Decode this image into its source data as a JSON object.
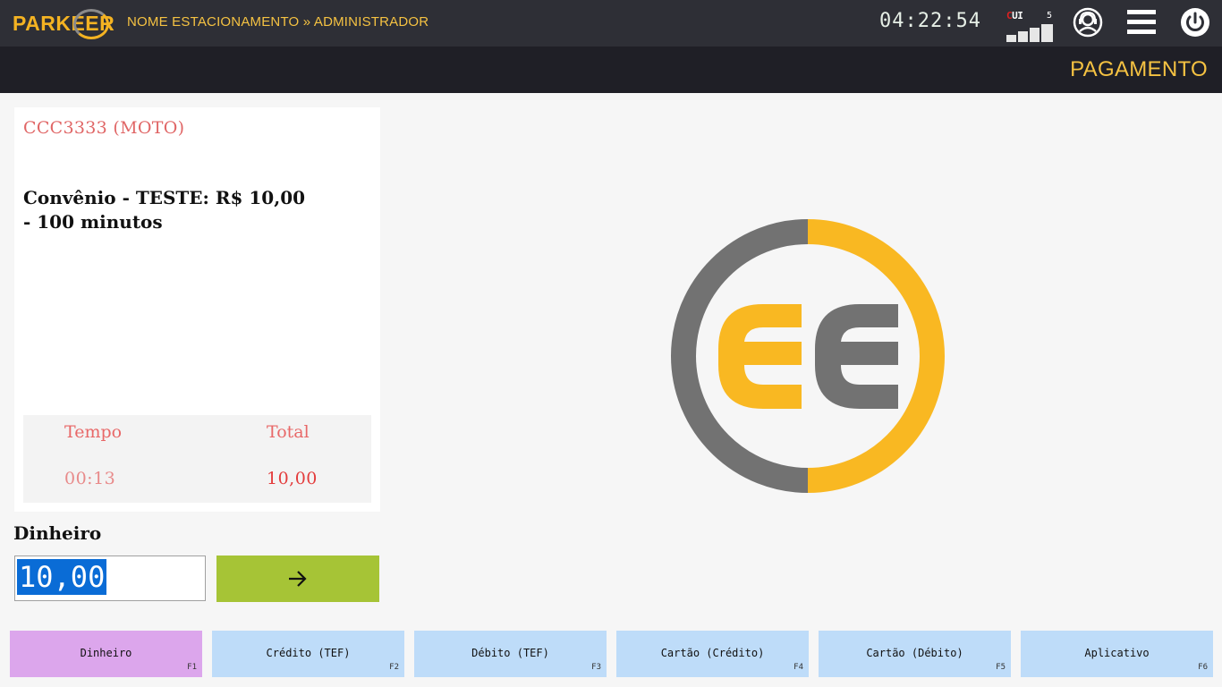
{
  "header": {
    "logo_text": "PARKEER",
    "breadcrumb": "NOME ESTACIONAMENTO » ADMINISTRADOR",
    "clock": "04:22:54",
    "cui": {
      "label_first": "C",
      "label_rest": "UI",
      "signal_count": "5"
    },
    "icons": [
      "support-icon",
      "menu-icon",
      "power-icon"
    ]
  },
  "title_strip": {
    "title": "PAGAMENTO"
  },
  "ticket": {
    "plate": "CCC3333 (MOTO)",
    "agreement_line1": "Convênio - TESTE: R$ 10,00",
    "agreement_line2": "- 100 minutos",
    "summary": {
      "time_label": "Tempo",
      "total_label": "Total",
      "time_value": "00:13",
      "total_value": "10,00"
    }
  },
  "payment": {
    "method_label": "Dinheiro",
    "amount_value": "10,00",
    "confirm_icon": "arrow-right-icon"
  },
  "methods": [
    {
      "label": "Dinheiro",
      "key": "F1"
    },
    {
      "label": "Crédito (TEF)",
      "key": "F2"
    },
    {
      "label": "Débito (TEF)",
      "key": "F3"
    },
    {
      "label": "Cartão (Crédito)",
      "key": "F4"
    },
    {
      "label": "Cartão (Débito)",
      "key": "F5"
    },
    {
      "label": "Aplicativo",
      "key": "F6"
    }
  ],
  "colors": {
    "accent_yellow": "#f4b322",
    "gray": "#727272",
    "confirm_green": "#a6c436",
    "method_blue": "#bedcf9",
    "method_active": "#dca6ec",
    "selection_blue": "#0a6cd6"
  }
}
